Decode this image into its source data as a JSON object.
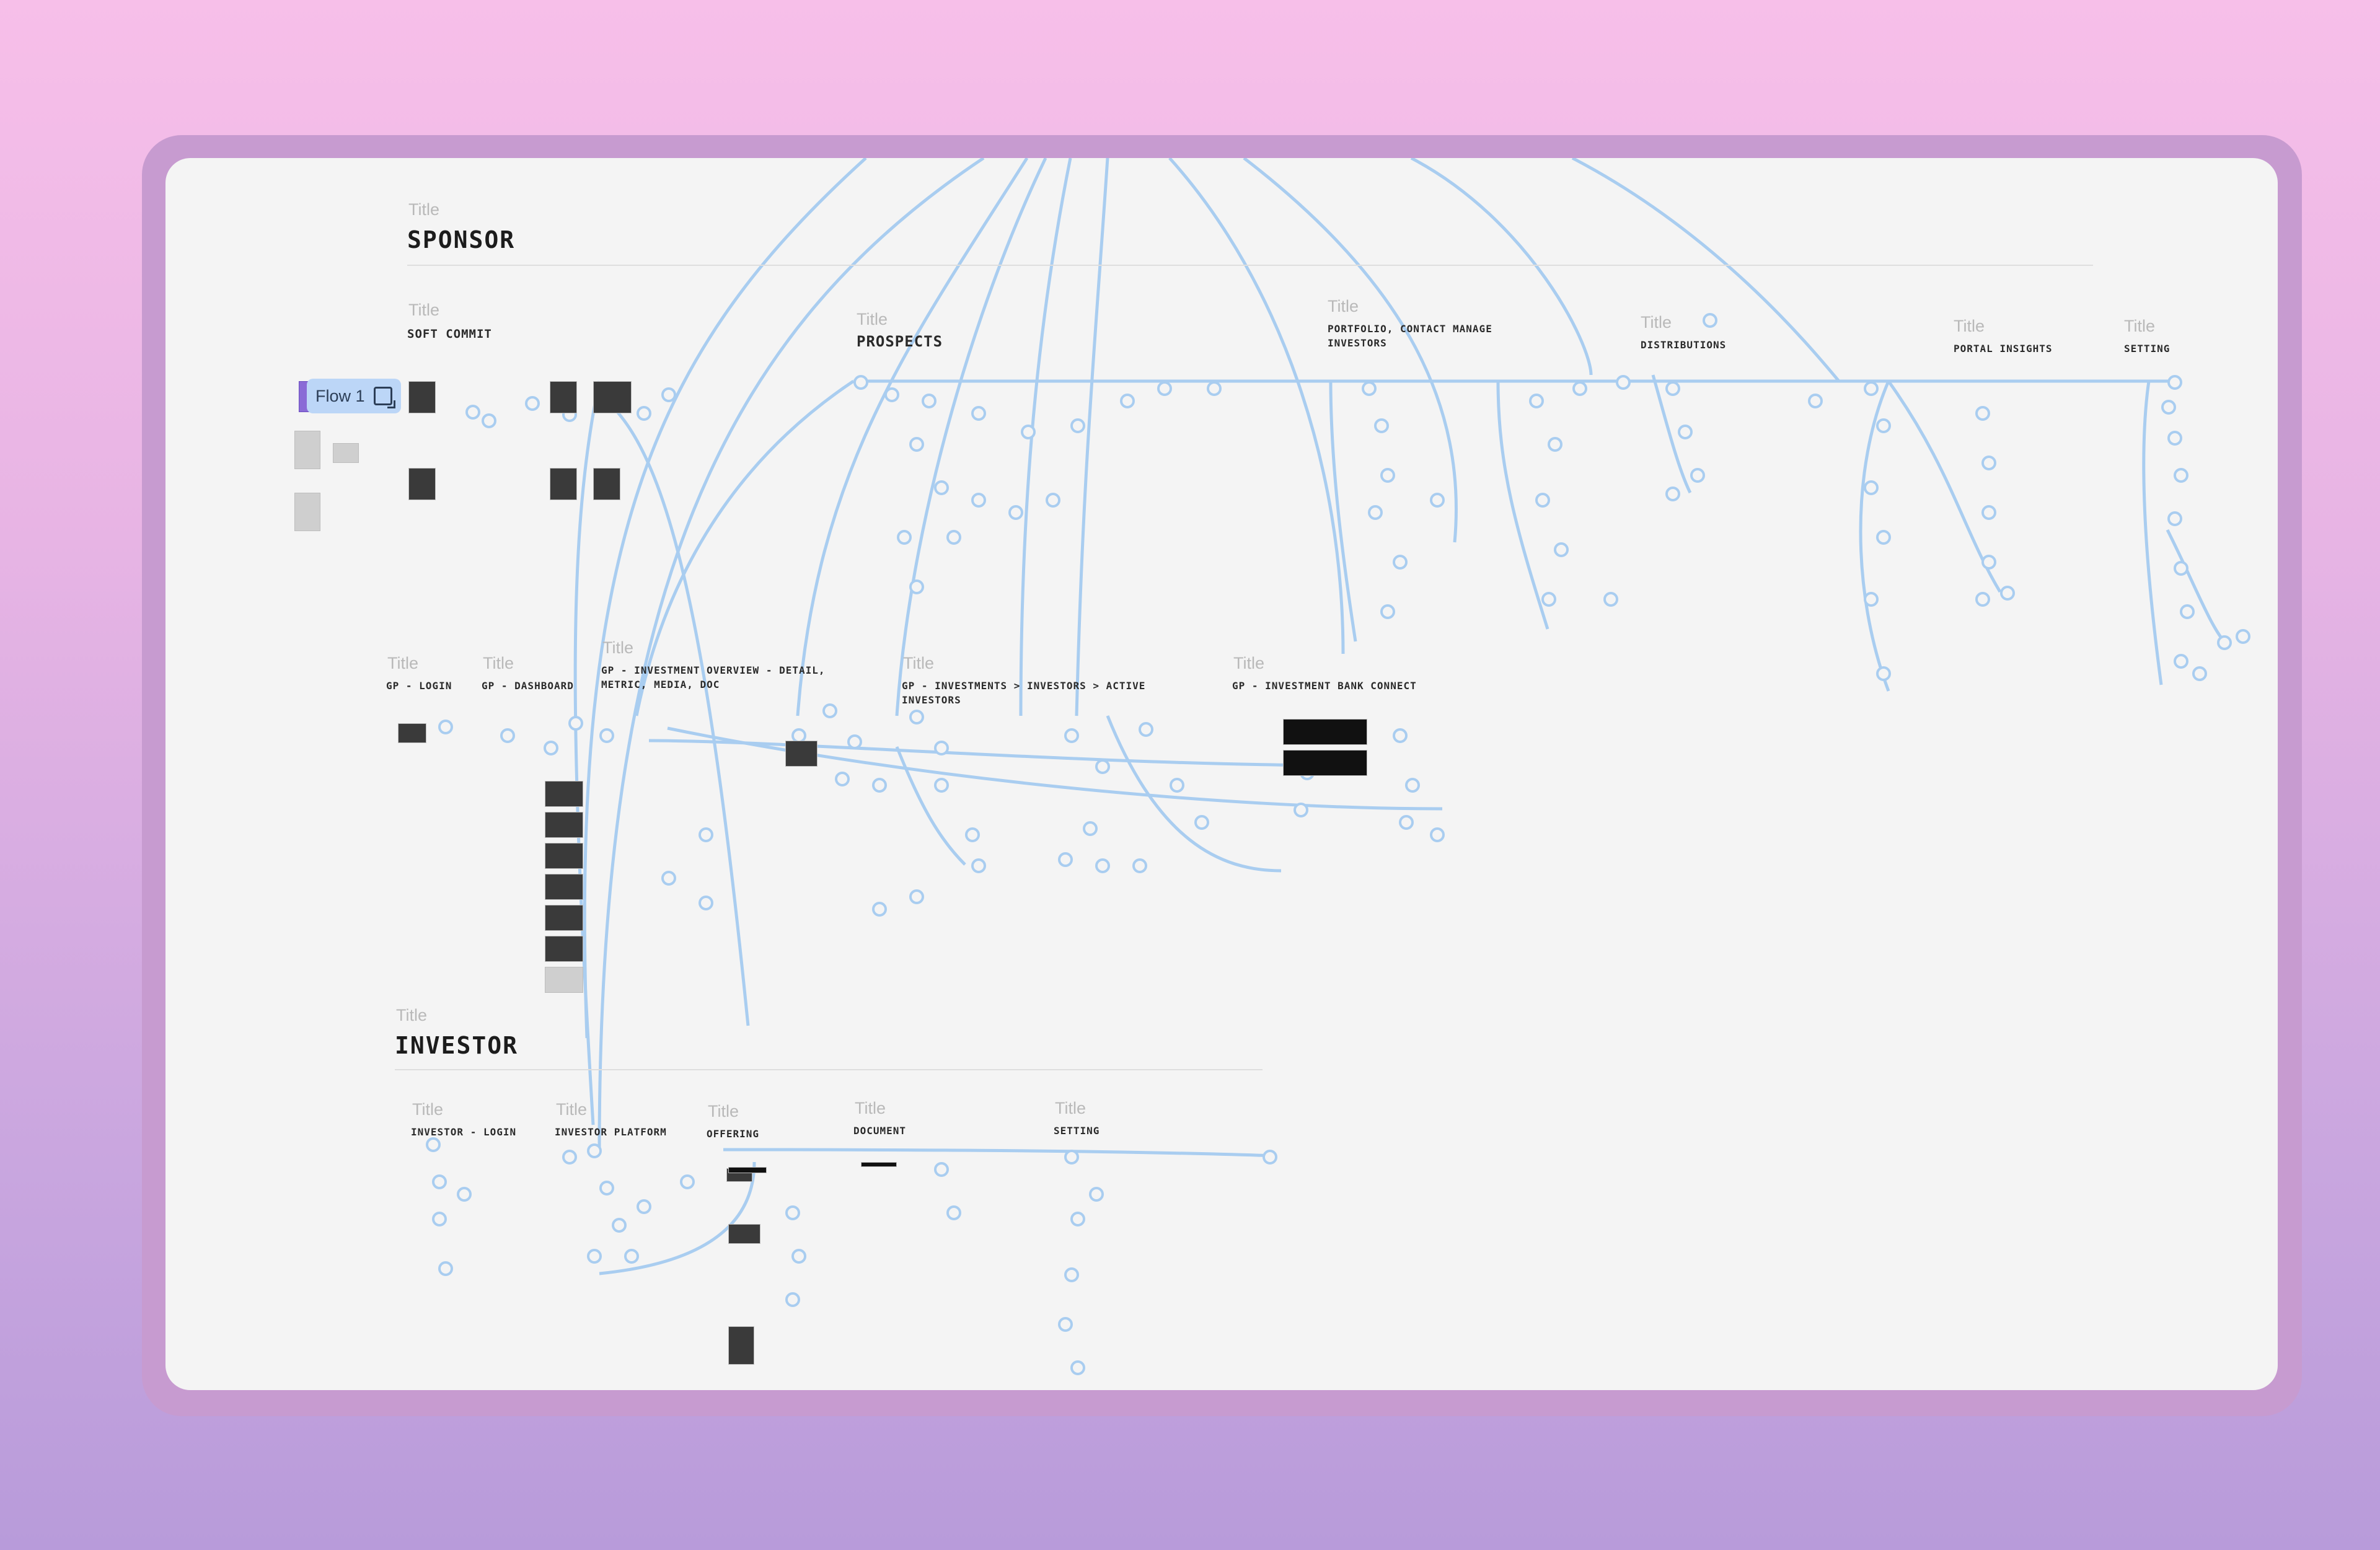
{
  "flow_tag": {
    "label": "Flow 1"
  },
  "labels": {
    "title_word": "Title"
  },
  "sponsor": {
    "heading": "SPONSOR",
    "groups": [
      {
        "id": "soft-commit",
        "title": "SOFT COMMIT"
      },
      {
        "id": "prospects",
        "title": "PROSPECTS"
      },
      {
        "id": "portfolio",
        "title": "PORTFOLIO, CONTACT MANAGE INVESTORS"
      },
      {
        "id": "distributions",
        "title": "DISTRIBUTIONS"
      },
      {
        "id": "portal-insights",
        "title": "PORTAL INSIGHTS"
      },
      {
        "id": "setting",
        "title": "SETTING"
      },
      {
        "id": "gp-login",
        "title": "GP - LOGIN"
      },
      {
        "id": "gp-dashboard",
        "title": "GP - DASHBOARD"
      },
      {
        "id": "gp-investment-overview",
        "title": "GP - INVESTMENT OVERVIEW - DETAIL, METRIC, MEDIA, DOC"
      },
      {
        "id": "gp-investments-investors",
        "title": "GP - INVESTMENTS > INVESTORS > ACTIVE INVESTORS"
      },
      {
        "id": "gp-investment-bank",
        "title": "GP - INVESTMENT BANK CONNECT"
      }
    ]
  },
  "investor": {
    "heading": "INVESTOR",
    "groups": [
      {
        "id": "investor-login",
        "title": "INVESTOR - LOGIN"
      },
      {
        "id": "investor-platform",
        "title": "INVESTOR PLATFORM"
      },
      {
        "id": "offering",
        "title": "OFFERING"
      },
      {
        "id": "document",
        "title": "DOCUMENT"
      },
      {
        "id": "investor-setting",
        "title": "SETTING"
      }
    ]
  },
  "colors": {
    "connector": "#a9cdf0",
    "canvas": "#f4f4f4",
    "flow_tag_bg": "#bcd6f7"
  }
}
